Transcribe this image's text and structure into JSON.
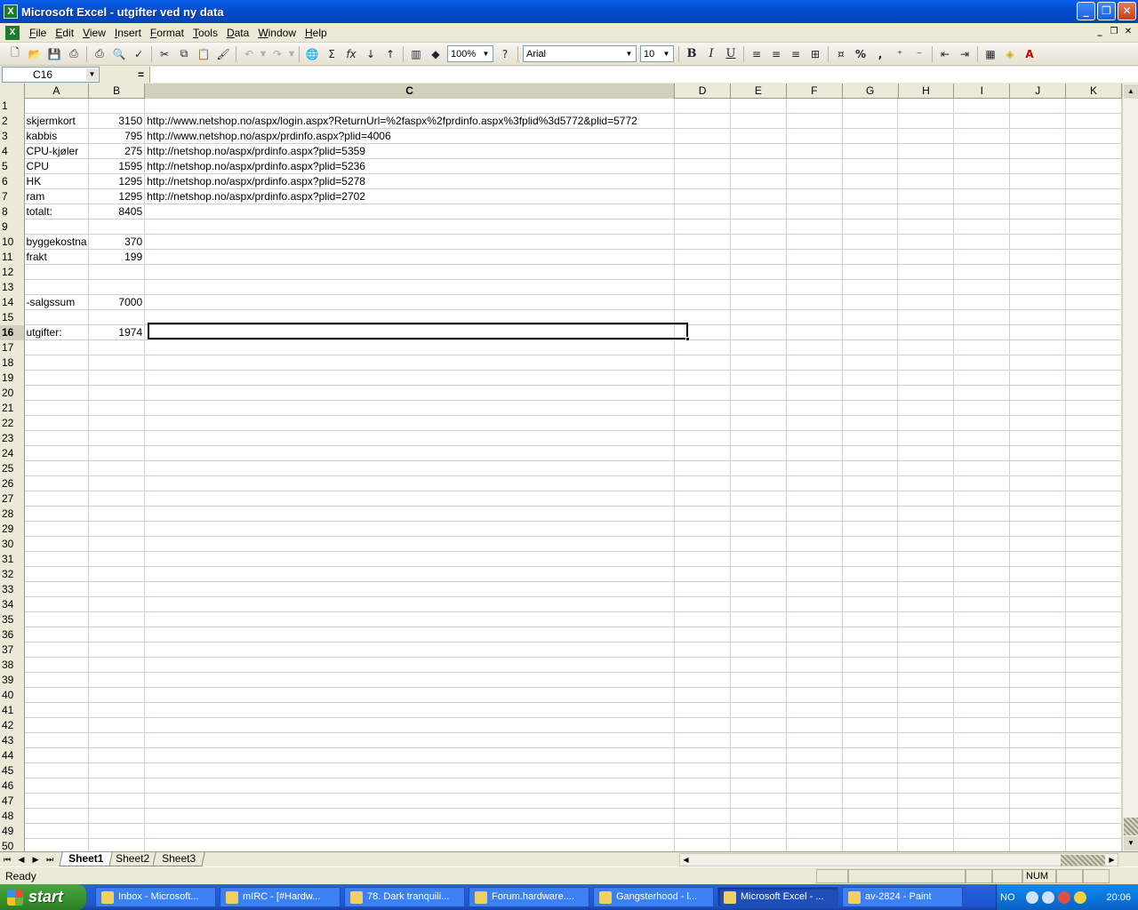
{
  "window": {
    "title": "Microsoft Excel - utgifter ved ny data"
  },
  "menu": [
    "File",
    "Edit",
    "View",
    "Insert",
    "Format",
    "Tools",
    "Data",
    "Window",
    "Help"
  ],
  "toolbar": {
    "zoom": "100%",
    "font": "Arial",
    "size": "10",
    "bold": "B",
    "italic": "I",
    "underline": "U",
    "percent": "%",
    "comma": ","
  },
  "formula_bar": {
    "name_box": "C16",
    "equals": "=",
    "formula": ""
  },
  "columns": [
    "A",
    "B",
    "C",
    "D",
    "E",
    "F",
    "G",
    "H",
    "I",
    "J",
    "K"
  ],
  "selected_cell": {
    "col": "C",
    "row": "16"
  },
  "cells": {
    "2": {
      "A": "skjermkort",
      "B": "3150",
      "C": "http://www.netshop.no/aspx/login.aspx?ReturnUrl=%2faspx%2fprdinfo.aspx%3fplid%3d5772&plid=5772"
    },
    "3": {
      "A": "kabbis",
      "B": "795",
      "C": "http://www.netshop.no/aspx/prdinfo.aspx?plid=4006"
    },
    "4": {
      "A": "CPU-kjøler",
      "B": "275",
      "C": "http://netshop.no/aspx/prdinfo.aspx?plid=5359"
    },
    "5": {
      "A": "CPU",
      "B": "1595",
      "C": "http://netshop.no/aspx/prdinfo.aspx?plid=5236"
    },
    "6": {
      "A": "HK",
      "B": "1295",
      "C": "http://netshop.no/aspx/prdinfo.aspx?plid=5278"
    },
    "7": {
      "A": "ram",
      "B": "1295",
      "C": "http://netshop.no/aspx/prdinfo.aspx?plid=2702"
    },
    "8": {
      "A": "totalt:",
      "B": "8405"
    },
    "10": {
      "A": "byggekostna",
      "B": "370"
    },
    "11": {
      "A": "frakt",
      "B": "199"
    },
    "14": {
      "A": "-salgssum",
      "B": "7000"
    },
    "16": {
      "A": "utgifter:",
      "B": "1974"
    }
  },
  "sheets": [
    "Sheet1",
    "Sheet2",
    "Sheet3"
  ],
  "active_sheet": "Sheet1",
  "status": {
    "text": "Ready",
    "num": "NUM"
  },
  "taskbar": {
    "start": "start",
    "tasks": [
      {
        "label": "Inbox - Microsoft...",
        "active": false
      },
      {
        "label": "mIRC - [#Hardw...",
        "active": false
      },
      {
        "label": "78. Dark tranquili...",
        "active": false
      },
      {
        "label": "Forum.hardware....",
        "active": false
      },
      {
        "label": "Gangsterhood - l...",
        "active": false
      },
      {
        "label": "Microsoft Excel - ...",
        "active": true
      },
      {
        "label": "av-2824 - Paint",
        "active": false
      }
    ],
    "lang": "NO",
    "clock": "20:06"
  }
}
